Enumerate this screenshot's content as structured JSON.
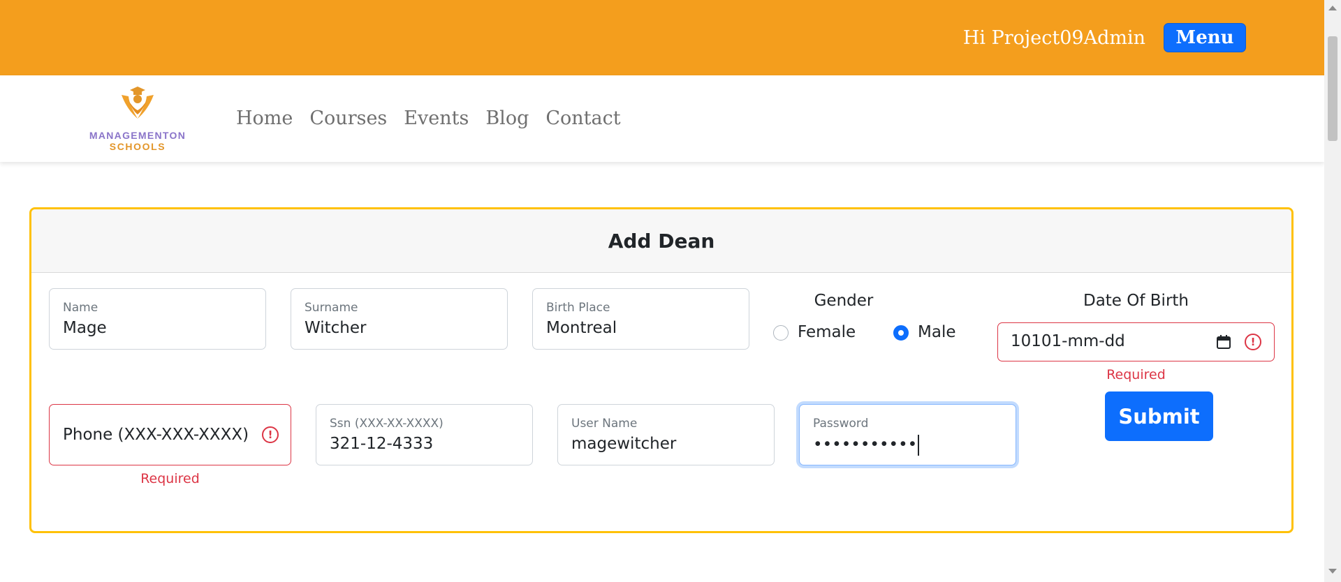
{
  "header": {
    "greeting": "Hi Project09Admin",
    "menu_label": "Menu"
  },
  "logo": {
    "line1": "MANAGEMENTON",
    "line2": "SCHOOLS"
  },
  "nav": {
    "items": [
      "Home",
      "Courses",
      "Events",
      "Blog",
      "Contact"
    ]
  },
  "form": {
    "title": "Add Dean",
    "name": {
      "label": "Name",
      "value": "Mage"
    },
    "surname": {
      "label": "Surname",
      "value": "Witcher"
    },
    "birth_place": {
      "label": "Birth Place",
      "value": "Montreal"
    },
    "gender": {
      "label": "Gender",
      "options": [
        "Female",
        "Male"
      ],
      "selected": "Male"
    },
    "date_of_birth": {
      "label": "Date Of Birth",
      "value": "10101-mm-dd",
      "error": "Required"
    },
    "phone": {
      "placeholder": "Phone (XXX-XXX-XXXX)",
      "error": "Required"
    },
    "ssn": {
      "label": "Ssn (XXX-XX-XXXX)",
      "value": "321-12-4333"
    },
    "username": {
      "label": "User Name",
      "value": "magewitcher"
    },
    "password": {
      "label": "Password",
      "value": "•••••••••••"
    },
    "submit_label": "Submit"
  },
  "colors": {
    "header_bg": "#f49e1d",
    "primary": "#0d6efd",
    "danger": "#dc3545",
    "card_border": "#ffc107"
  }
}
